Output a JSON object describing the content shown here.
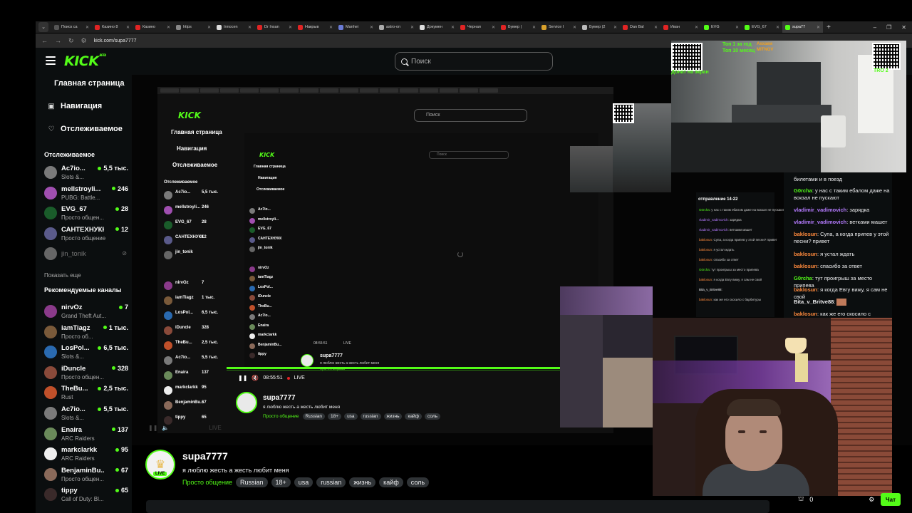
{
  "browser": {
    "tabs": [
      {
        "label": "Поиск ca",
        "color": "#555"
      },
      {
        "label": "Казино 8",
        "color": "#e02424"
      },
      {
        "label": "Казино",
        "color": "#e02424"
      },
      {
        "label": "https",
        "color": "#888"
      },
      {
        "label": "Innocen",
        "color": "#ddd"
      },
      {
        "label": "Dr Insan",
        "color": "#e02424"
      },
      {
        "label": "Накрыв",
        "color": "#e02424"
      },
      {
        "label": "Manhei",
        "color": "#6a7bd6"
      },
      {
        "label": "astro-on",
        "color": "#aaa"
      },
      {
        "label": "Докумен",
        "color": "#ddd"
      },
      {
        "label": "Черная",
        "color": "#e02424"
      },
      {
        "label": "Бумер |",
        "color": "#e02424"
      },
      {
        "label": "Service I",
        "color": "#d9a12b"
      },
      {
        "label": "Бумер (2",
        "color": "#bbb"
      },
      {
        "label": "Dan Bal",
        "color": "#e02424"
      },
      {
        "label": "Иван",
        "color": "#e02424"
      },
      {
        "label": "EVG",
        "color": "#53fc18"
      },
      {
        "label": "EVG_67",
        "color": "#53fc18"
      },
      {
        "label": "supa77",
        "color": "#53fc18"
      }
    ],
    "url": "kick.com/supa7777"
  },
  "header": {
    "logo": "KICK",
    "logo_sup": "BETA",
    "search_placeholder": "Поиск"
  },
  "sidebar": {
    "main": [
      {
        "label": "Главная страница"
      },
      {
        "label": "Навигация"
      },
      {
        "label": "Отслеживаемое"
      }
    ],
    "followed_title": "Отслеживаемое",
    "followed": [
      {
        "name": "Ac7io...",
        "category": "Slots &...",
        "viewers": "5,5 тыс.",
        "color": "#7a7a7a"
      },
      {
        "name": "mellstroyli...",
        "category": "PUBG: Battle...",
        "viewers": "246",
        "color": "#a04fb0"
      },
      {
        "name": "EVG_67",
        "category": "Просто общен...",
        "viewers": "28",
        "color": "#1a5c2a"
      },
      {
        "name": "САНТЕХНУКК",
        "category": "Просто общение",
        "viewers": "12",
        "color": "#5a5a8a"
      },
      {
        "name": "jin_tonik",
        "category": "",
        "viewers": "",
        "color": "#666"
      }
    ],
    "show_more": "Показать еще",
    "recommended_title": "Рекомендуемые каналы",
    "recommended": [
      {
        "name": "nirvOz",
        "category": "Grand Theft Aut...",
        "viewers": "7",
        "color": "#8a3a8a"
      },
      {
        "name": "iamTiagz",
        "category": "Просто об...",
        "viewers": "1 тыс.",
        "color": "#7a5a3a"
      },
      {
        "name": "LosPol...",
        "category": "Slots &...",
        "viewers": "6,5 тыс.",
        "color": "#2a6ab0"
      },
      {
        "name": "iDuncle",
        "category": "Просто общен...",
        "viewers": "328",
        "color": "#8a4a3a"
      },
      {
        "name": "TheBu...",
        "category": "Rust",
        "viewers": "2,5 тыс.",
        "color": "#c0502a"
      },
      {
        "name": "Ac7io...",
        "category": "Slots &...",
        "viewers": "5,5 тыс.",
        "color": "#7a7a7a"
      },
      {
        "name": "Enaira",
        "category": "ARC Raiders",
        "viewers": "137",
        "color": "#6a8a5a"
      },
      {
        "name": "markclarkk",
        "category": "ARC Raiders",
        "viewers": "95",
        "color": "#eee"
      },
      {
        "name": "BenjaminBu...",
        "category": "Просто общен...",
        "viewers": "67",
        "color": "#8a6a5a"
      },
      {
        "name": "tippy",
        "category": "Call of Duty: Bl...",
        "viewers": "65",
        "color": "#3a2a2a"
      }
    ]
  },
  "stream": {
    "channel": "supa7777",
    "description": "я люблю жесть а жесть любит меня",
    "category": "Просто общение",
    "tags": [
      "Russian",
      "18+",
      "usa",
      "russian",
      "жизнь",
      "кайф",
      "соль"
    ],
    "live_badge": "LIVE",
    "time_nested": "08:55:51",
    "live_nested": "LIVE"
  },
  "overlay": {
    "top1": "Топ 1 за год",
    "top10": "Топ 10 месяц",
    "donate": "Донат на экран",
    "alert_user": "Аххаем",
    "alert_sub": "MITNOV",
    "tro": "TRO 2"
  },
  "chat": {
    "top_line": "билетами и в поезд",
    "messages": [
      {
        "user": "G0rcha",
        "text": "у нас с таким ебалом даже на вокзал не пускают",
        "color": "#53fc18"
      },
      {
        "user": "vladimir_vadimovich",
        "text": "зарядка",
        "color": "#b57bff"
      },
      {
        "user": "vladimir_vadimovich",
        "text": "ветками машет",
        "color": "#b57bff"
      },
      {
        "user": "baklosun",
        "text": "Супа, а когда припев у этой песни? привет",
        "color": "#ff8a3d"
      },
      {
        "user": "baklosun",
        "text": "я устал ждать",
        "color": "#ff8a3d"
      },
      {
        "user": "baklosun",
        "text": "спасибо за ответ",
        "color": "#ff8a3d"
      },
      {
        "user": "G0rcha",
        "text": "тут проигрыш за место припева",
        "color": "#53fc18"
      },
      {
        "user": "baklosun",
        "text": "я когда Евгу вижу, я сам не свой",
        "color": "#ff8a3d"
      },
      {
        "user": "Bita_v_Britve88",
        "text": "",
        "color": "#efeff1"
      },
      {
        "user": "baklosun",
        "text": "как же его скосило с барбитуры",
        "color": "#ff8a3d"
      }
    ],
    "viewer_count": "0",
    "chat_button": "Чат",
    "nested_header": "отправление 14-22"
  }
}
